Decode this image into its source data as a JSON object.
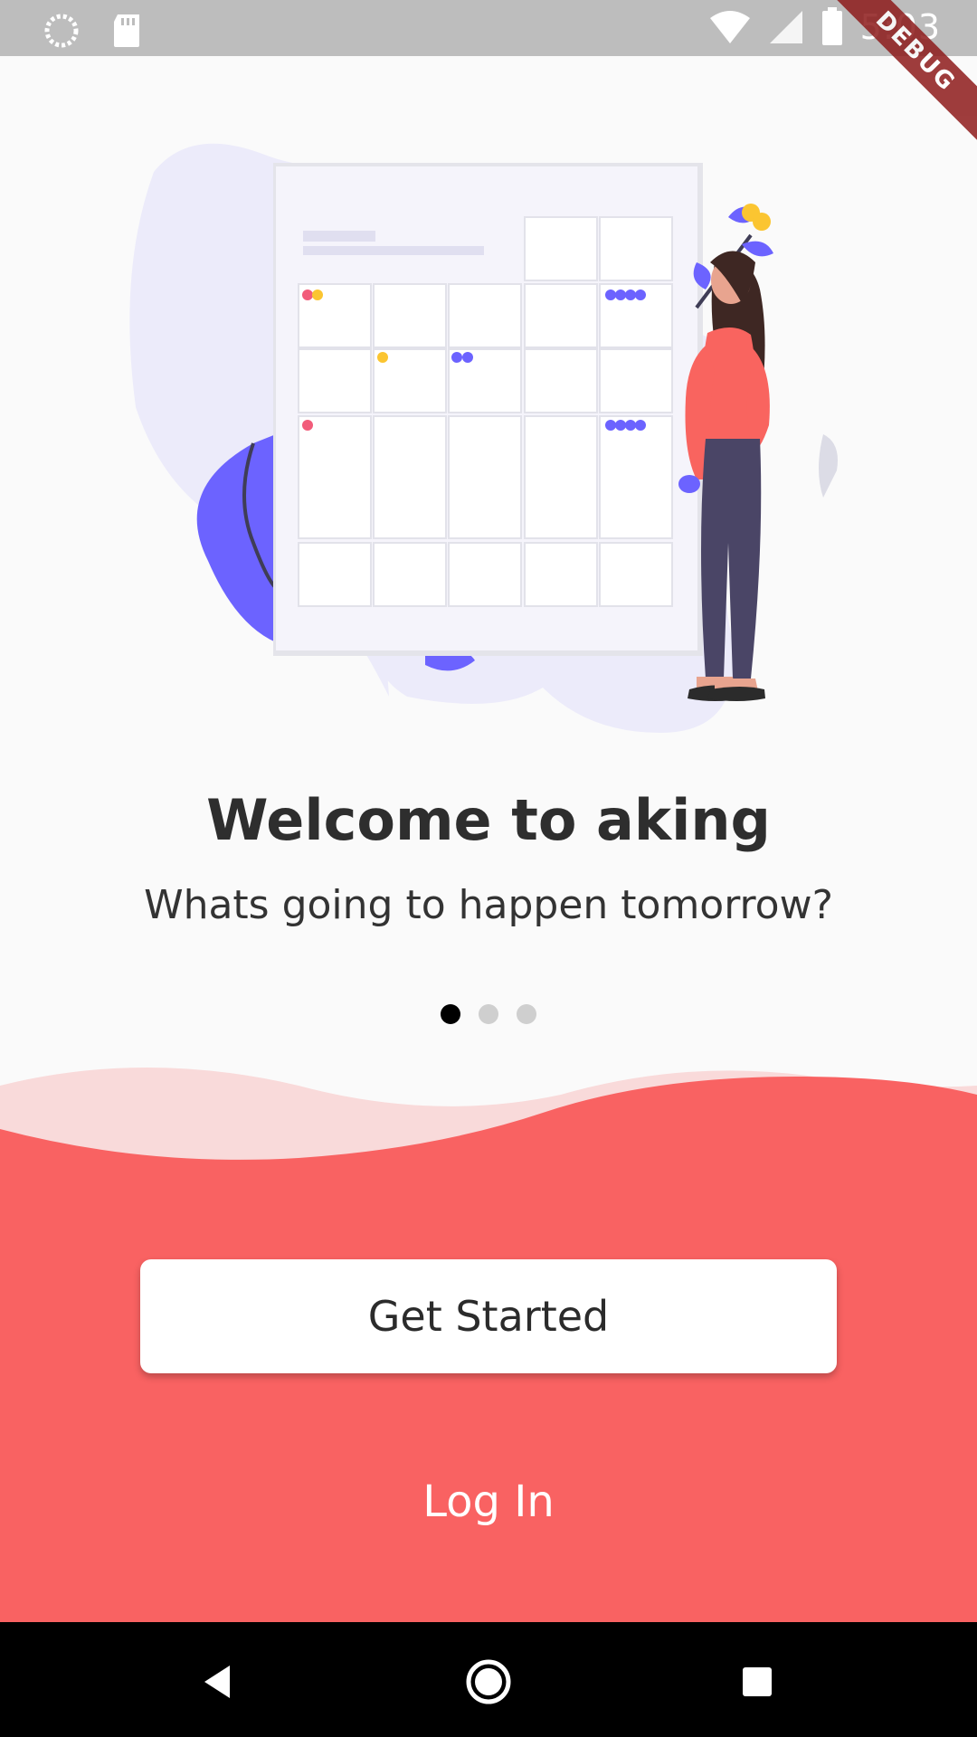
{
  "status_bar": {
    "time": "5:03",
    "icons": [
      "loading-circle-icon",
      "sd-card-icon",
      "wifi-icon",
      "signal-icon",
      "battery-icon"
    ]
  },
  "debug_banner": "DEBUG",
  "onboarding": {
    "title": "Welcome to aking",
    "subtitle": "Whats going to happen tomorrow?",
    "page_indicator": {
      "current": 1,
      "total": 3
    }
  },
  "actions": {
    "get_started_label": "Get Started",
    "login_label": "Log In"
  },
  "nav_bar": {
    "icons": [
      "back-icon",
      "home-icon",
      "recents-icon"
    ]
  },
  "colors": {
    "accent": "#f96262",
    "wave_light": "#f9dada",
    "illustration_blob": "#ecebfa",
    "illustration_purple": "#6c63ff"
  }
}
